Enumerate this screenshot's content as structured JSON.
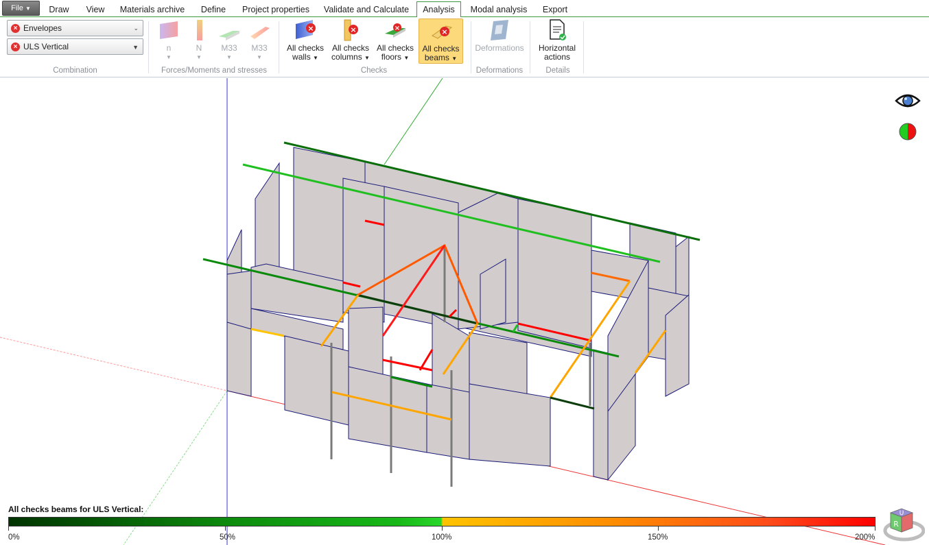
{
  "menu": {
    "file_label": "File",
    "tabs": [
      {
        "label": "Draw"
      },
      {
        "label": "View"
      },
      {
        "label": "Materials archive"
      },
      {
        "label": "Define"
      },
      {
        "label": "Project properties"
      },
      {
        "label": "Validate and Calculate"
      },
      {
        "label": "Analysis"
      },
      {
        "label": "Modal analysis"
      },
      {
        "label": "Export"
      }
    ],
    "active_tab": "Analysis"
  },
  "ribbon": {
    "combination": {
      "envelopes": "Envelopes",
      "load_case": "ULS Vertical",
      "group_label": "Combination"
    },
    "forces": {
      "n_small": "n",
      "n_big": "N",
      "m33_a": "M33",
      "m33_b": "M33",
      "group_label": "Forces/Moments and stresses"
    },
    "checks": {
      "walls_line1": "All checks",
      "walls_line2": "walls",
      "columns_line1": "All checks",
      "columns_line2": "columns",
      "floors_line1": "All checks",
      "floors_line2": "floors",
      "beams_line1": "All checks",
      "beams_line2": "beams",
      "group_label": "Checks"
    },
    "deformations": {
      "button": "Deformations",
      "group_label": "Deformations"
    },
    "details": {
      "line1": "Horizontal",
      "line2": "actions",
      "group_label": "Details"
    }
  },
  "legend": {
    "title": "All checks beams for ULS Vertical:",
    "ticks": [
      "0%",
      "50%",
      "100%",
      "150%",
      "200%"
    ]
  },
  "viewcube": {
    "face_top": "U",
    "face_front": "R"
  },
  "colors": {
    "accent": "#3a9a3a",
    "ratio_low": "#003300",
    "ratio_ok": "#1fbf1f",
    "ratio_warn": "#ffa500",
    "ratio_fail": "#ff0000",
    "wall_fill": "#d2cccc",
    "wall_edge": "#1a1a7a"
  }
}
